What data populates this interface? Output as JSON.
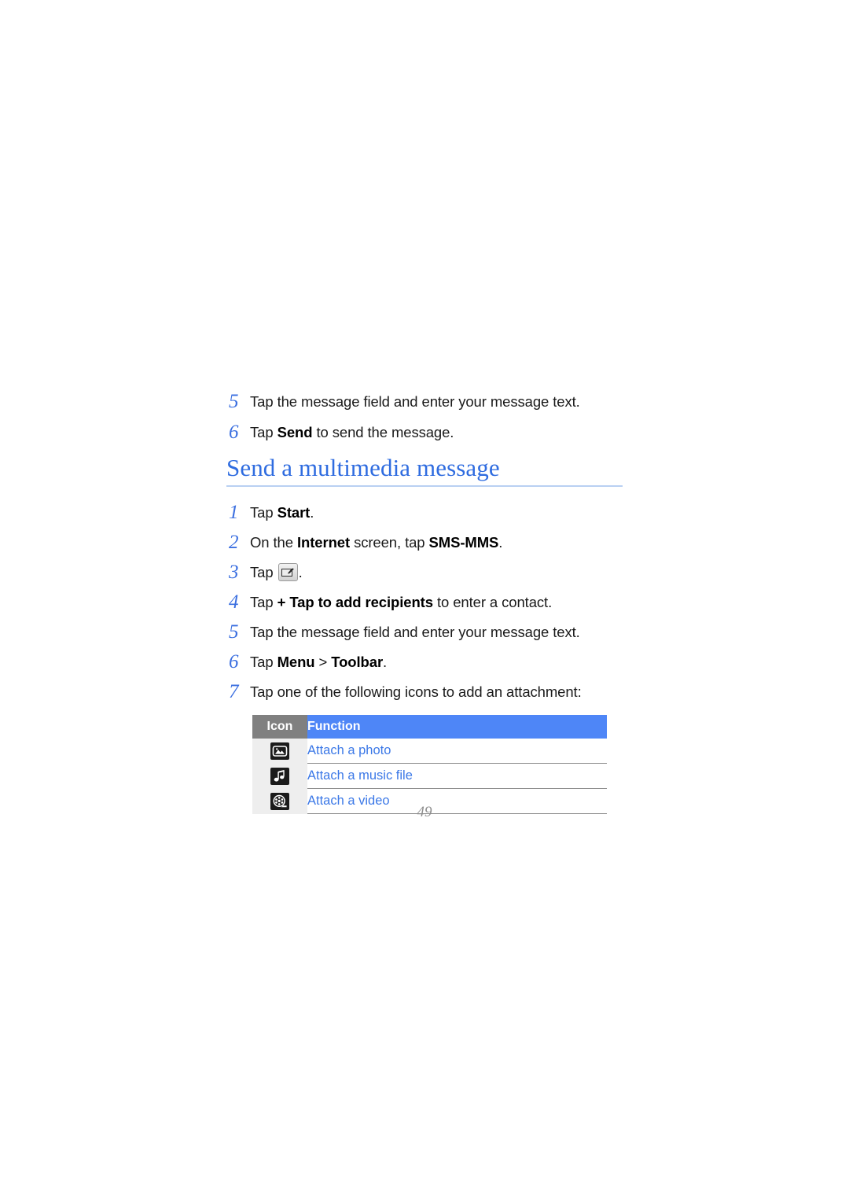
{
  "document": {
    "page_number": "49",
    "colors": {
      "heading": "#2f6ce0",
      "step_number": "#3b6fe0",
      "table_header_icon_bg": "#808080",
      "table_header_function_bg": "#4e86f7",
      "table_link_text": "#3b78e7",
      "heading_rule": "#b9d0f2",
      "icon_cell_bg": "#eeeeee"
    }
  },
  "top_steps": [
    {
      "number": "5",
      "parts": [
        {
          "text": "Tap the message field and enter your message text.",
          "bold": false
        }
      ]
    },
    {
      "number": "6",
      "parts": [
        {
          "text": "Tap ",
          "bold": false
        },
        {
          "text": "Send",
          "bold": true
        },
        {
          "text": " to send the message.",
          "bold": false
        }
      ]
    }
  ],
  "section": {
    "heading": "Send a multimedia message"
  },
  "steps": [
    {
      "number": "1",
      "parts": [
        {
          "text": "Tap ",
          "bold": false
        },
        {
          "text": "Start",
          "bold": true
        },
        {
          "text": ".",
          "bold": false
        }
      ]
    },
    {
      "number": "2",
      "parts": [
        {
          "text": "On the ",
          "bold": false
        },
        {
          "text": "Internet",
          "bold": true
        },
        {
          "text": " screen, tap ",
          "bold": false
        },
        {
          "text": "SMS-MMS",
          "bold": true
        },
        {
          "text": ".",
          "bold": false
        }
      ]
    },
    {
      "number": "3",
      "icon": "compose-message-icon",
      "parts": [
        {
          "text": "Tap ",
          "bold": false
        },
        {
          "text": "__ICON__",
          "bold": false
        },
        {
          "text": ".",
          "bold": false
        }
      ]
    },
    {
      "number": "4",
      "parts": [
        {
          "text": "Tap ",
          "bold": false
        },
        {
          "text": "+ Tap to add recipients",
          "bold": true
        },
        {
          "text": " to enter a contact.",
          "bold": false
        }
      ]
    },
    {
      "number": "5",
      "parts": [
        {
          "text": "Tap the message field and enter your message text.",
          "bold": false
        }
      ]
    },
    {
      "number": "6",
      "parts": [
        {
          "text": "Tap ",
          "bold": false
        },
        {
          "text": "Menu",
          "bold": true
        },
        {
          "text": " > ",
          "bold": false
        },
        {
          "text": "Toolbar",
          "bold": true
        },
        {
          "text": ".",
          "bold": false
        }
      ]
    },
    {
      "number": "7",
      "parts": [
        {
          "text": "Tap one of the following icons to add an attachment:",
          "bold": false
        }
      ]
    }
  ],
  "table": {
    "headers": {
      "icon": "Icon",
      "function": "Function"
    },
    "rows": [
      {
        "icon_name": "photo-icon",
        "function": "Attach a photo"
      },
      {
        "icon_name": "music-note-icon",
        "function": "Attach a music file"
      },
      {
        "icon_name": "film-reel-icon",
        "function": "Attach a video"
      }
    ]
  }
}
